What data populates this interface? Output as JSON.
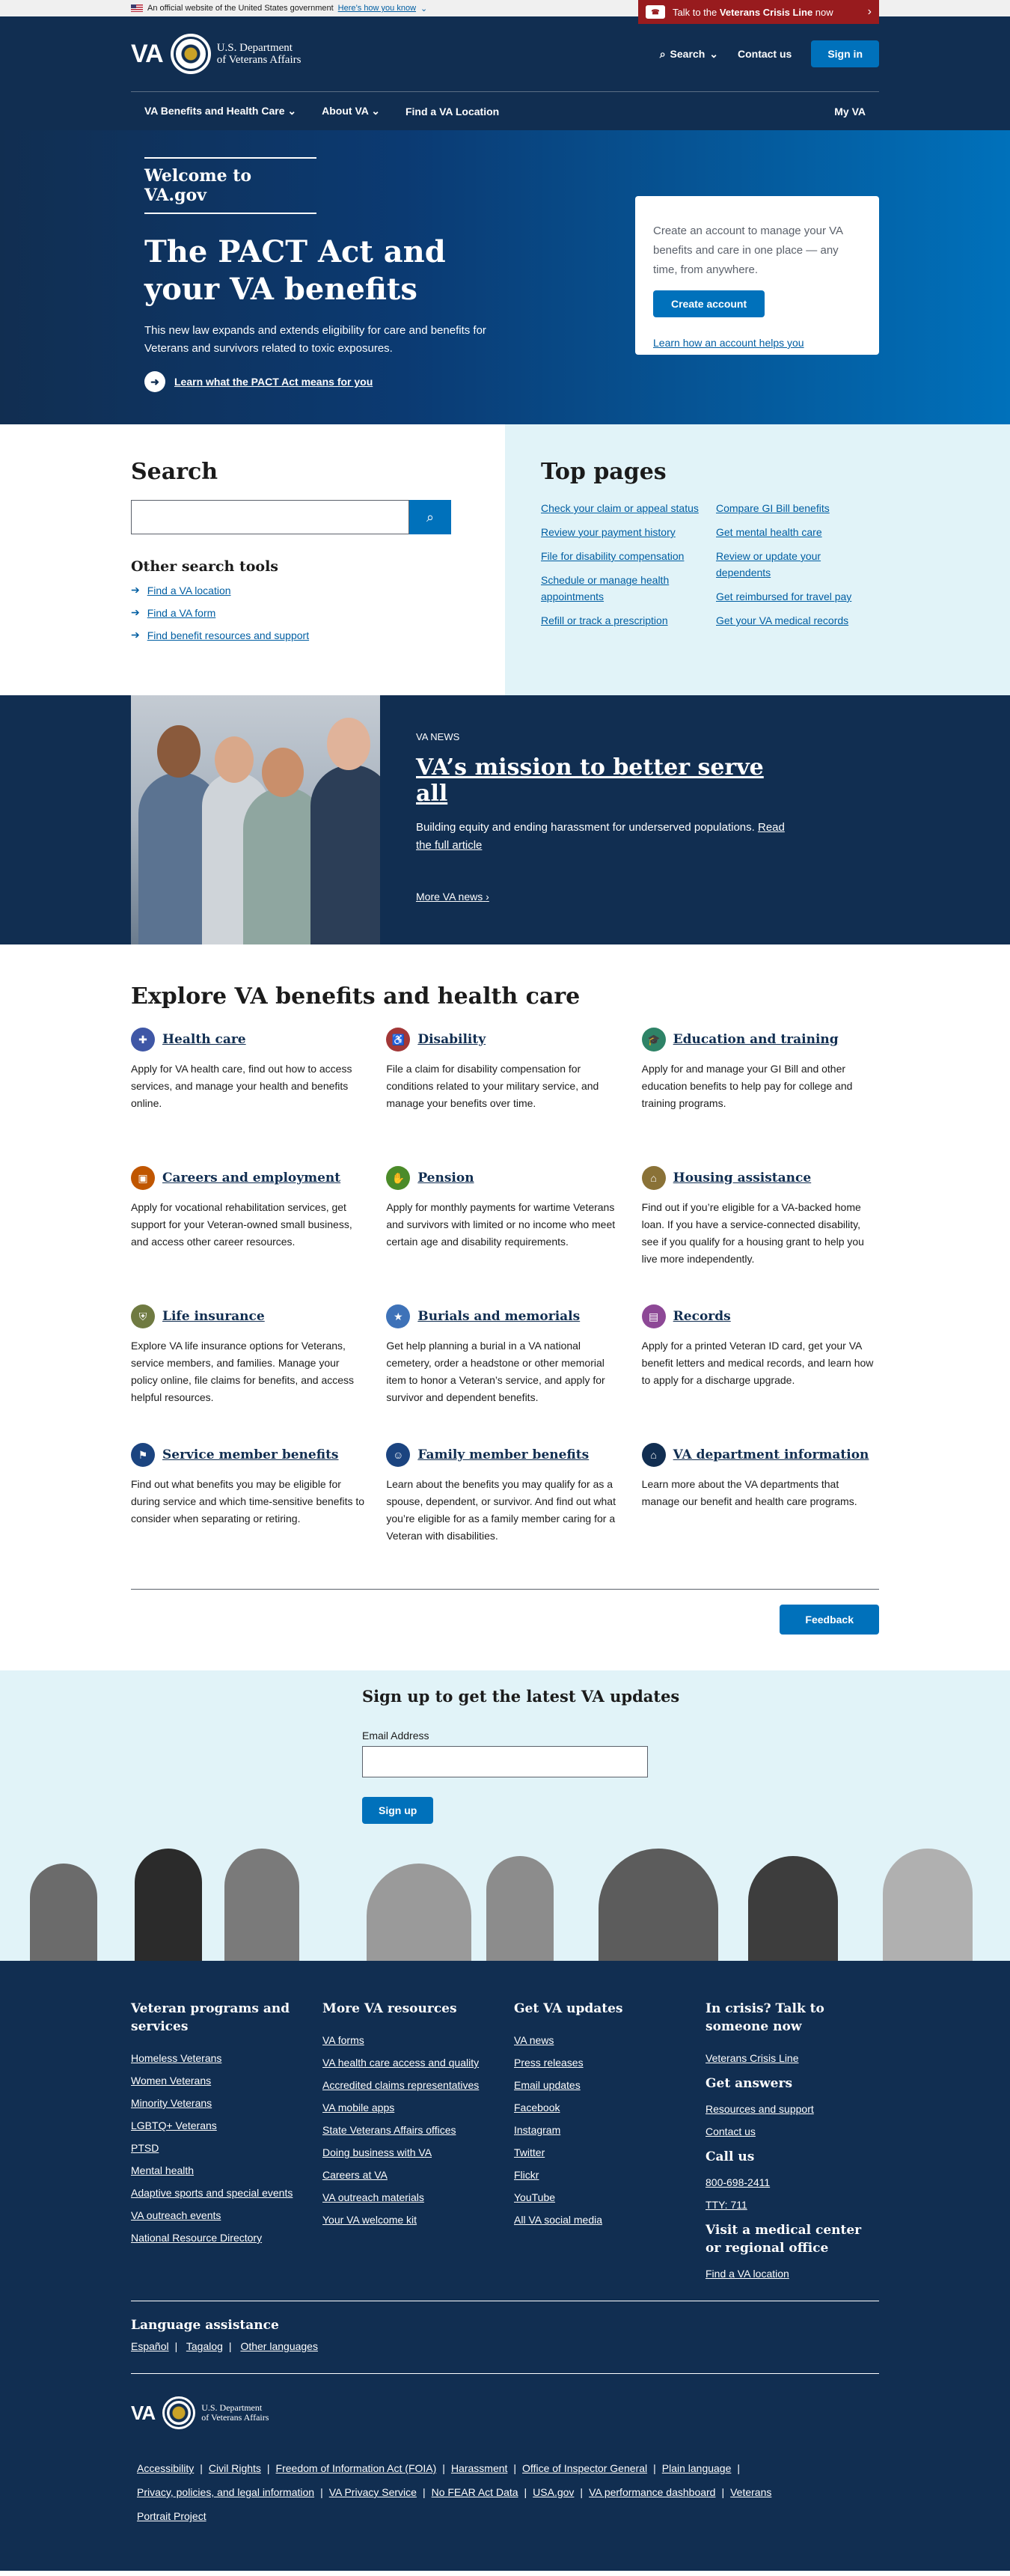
{
  "gov_banner": {
    "text": "An official website of the United States government",
    "how_link": "Here’s how you know"
  },
  "crisis": {
    "prefix": "Talk to the",
    "bold": "Veterans Crisis Line",
    "suffix": "now"
  },
  "header": {
    "logo_text": "VA",
    "dept_line1": "U.S. Department",
    "dept_line2": "of Veterans Affairs",
    "search_label": "Search",
    "contact_label": "Contact us",
    "signin_label": "Sign in"
  },
  "nav": {
    "items": [
      "VA Benefits and Health Care",
      "About VA",
      "Find a VA Location"
    ],
    "myva": "My VA"
  },
  "hero": {
    "welcome": "Welcome to VA.gov",
    "title": "The PACT Act and your VA benefits",
    "description": "This new law expands and extends eligibility for care and benefits for Veterans and survivors related to toxic exposures.",
    "learn_link": "Learn what the PACT Act means for you",
    "card_text": "Create an account to manage your VA benefits and care in one place — any time, from anywhere.",
    "card_button": "Create account",
    "card_link": "Learn how an account helps you"
  },
  "search": {
    "title": "Search",
    "input_value": "",
    "other_title": "Other search tools",
    "other_links": [
      "Find a VA location",
      "Find a VA form",
      "Find benefit resources and support"
    ]
  },
  "top_pages": {
    "title": "Top pages",
    "col1": [
      "Check your claim or appeal status",
      "Review your payment history",
      "File for disability compensation",
      "Schedule or manage health appointments",
      "Refill or track a prescription"
    ],
    "col2": [
      "Compare GI Bill benefits",
      "Get mental health care",
      "Review or update your dependents",
      "Get reimbursed for travel pay",
      "Get your VA medical records"
    ]
  },
  "news": {
    "kicker": "VA NEWS",
    "title": "VA’s mission to better serve all",
    "description": "Building equity and ending harassment for underserved populations.",
    "read_link": "Read the full article",
    "more_link": "More VA news"
  },
  "explore": {
    "title": "Explore VA benefits and health care",
    "benefits": [
      {
        "title": "Health care",
        "desc": "Apply for VA health care, find out how to access services, and manage your health and benefits online.",
        "color": "#3f57a6",
        "icon": "medical-bag-icon",
        "glyph": "✚"
      },
      {
        "title": "Disability",
        "desc": "File a claim for disability compensation for conditions related to your military service, and manage your benefits over time.",
        "color": "#a23737",
        "icon": "disability-icon",
        "glyph": "♿"
      },
      {
        "title": "Education and training",
        "desc": "Apply for and manage your GI Bill and other education benefits to help pay for college and training programs.",
        "color": "#2e8367",
        "icon": "graduation-cap-icon",
        "glyph": "🎓"
      },
      {
        "title": "Careers and employment",
        "desc": "Apply for vocational rehabilitation services, get support for your Veteran-owned small business, and access other career resources.",
        "color": "#c05600",
        "icon": "briefcase-icon",
        "glyph": "▣"
      },
      {
        "title": "Pension",
        "desc": "Apply for monthly payments for wartime Veterans and survivors with limited or no income who meet certain age and disability requirements.",
        "color": "#4b8b29",
        "icon": "handshake-icon",
        "glyph": "✋"
      },
      {
        "title": "Housing assistance",
        "desc": "Find out if you’re eligible for a VA-backed home loan. If you have a service-connected disability, see if you qualify for a housing grant to help you live more independently.",
        "color": "#8a7237",
        "icon": "home-icon",
        "glyph": "⌂"
      },
      {
        "title": "Life insurance",
        "desc": "Explore VA life insurance options for Veterans, service members, and families. Manage your policy online, file claims for benefits, and access helpful resources.",
        "color": "#6f7a41",
        "icon": "shield-icon",
        "glyph": "⛨"
      },
      {
        "title": "Burials and memorials",
        "desc": "Get help planning a burial in a VA national cemetery, order a headstone or other memorial item to honor a Veteran’s service, and apply for survivor and dependent benefits.",
        "color": "#3e72b8",
        "icon": "flag-star-icon",
        "glyph": "★"
      },
      {
        "title": "Records",
        "desc": "Apply for a printed Veteran ID card, get your VA benefit letters and medical records, and learn how to apply for a discharge upgrade.",
        "color": "#8d4896",
        "icon": "id-card-icon",
        "glyph": "▤"
      },
      {
        "title": "Service member benefits",
        "desc": "Find out what benefits you may be eligible for during service and which time-sensitive benefits to consider when separating or retiring.",
        "color": "#1b4480",
        "icon": "flag-icon",
        "glyph": "⚑"
      },
      {
        "title": "Family member benefits",
        "desc": "Learn about the benefits you may qualify for as a spouse, dependent, or survivor. And find out what you’re eligible for as a family member caring for a Veteran with disabilities.",
        "color": "#1b4480",
        "icon": "family-icon",
        "glyph": "☺"
      },
      {
        "title": "VA department information",
        "desc": "Learn more about the VA departments that manage our benefit and health care programs.",
        "color": "#112e51",
        "icon": "building-icon",
        "glyph": "⌂"
      }
    ],
    "feedback": "Feedback"
  },
  "signup": {
    "title": "Sign up to get the latest VA updates",
    "email_label": "Email Address",
    "email_value": "",
    "button": "Sign up"
  },
  "footer": {
    "col1_title": "Veteran programs and services",
    "col1": [
      "Homeless Veterans",
      "Women Veterans",
      "Minority Veterans",
      "LGBTQ+ Veterans",
      "PTSD",
      "Mental health",
      "Adaptive sports and special events",
      "VA outreach events",
      "National Resource Directory"
    ],
    "col2_title": "More VA resources",
    "col2": [
      "VA forms",
      "VA health care access and quality",
      "Accredited claims representatives",
      "VA mobile apps",
      "State Veterans Affairs offices",
      "Doing business with VA",
      "Careers at VA",
      "VA outreach materials",
      "Your VA welcome kit"
    ],
    "col3_title": "Get VA updates",
    "col3": [
      "VA news",
      "Press releases",
      "Email updates",
      "Facebook",
      "Instagram",
      "Twitter",
      "Flickr",
      "YouTube",
      "All VA social media"
    ],
    "col4_title": "In crisis? Talk to someone now",
    "col4_crisis": "Veterans Crisis Line",
    "answers_title": "Get answers",
    "answers": [
      "Resources and support",
      "Contact us"
    ],
    "call_title": "Call us",
    "phone": "800-698-2411",
    "tty": "TTY: 711",
    "visit_title": "Visit a medical center or regional office",
    "visit_link": "Find a VA location",
    "lang_title": "Language assistance",
    "lang_links": [
      "Español",
      "Tagalog",
      "Other languages"
    ],
    "legal": [
      "Accessibility",
      "Civil Rights",
      "Freedom of Information Act (FOIA)",
      "Harassment",
      "Office of Inspector General",
      "Plain language",
      "Privacy, policies, and legal information",
      "VA Privacy Service",
      "No FEAR Act Data",
      "USA.gov",
      "VA performance dashboard",
      "Veterans Portrait Project"
    ]
  }
}
